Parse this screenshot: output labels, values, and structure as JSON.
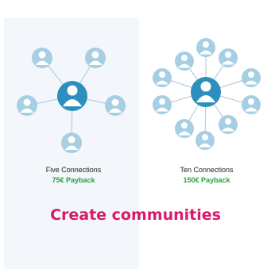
{
  "colors": {
    "node": "#a6cfe3",
    "hub": "#2d8fbe",
    "line": "#b7cfdd",
    "payback": "#2ea043",
    "headline": "#d81b6a"
  },
  "left_card": {
    "caption": "Five Connections",
    "payback": "75€ Payback"
  },
  "right_card": {
    "caption": "Ten Connections",
    "payback": "150€ Payback"
  },
  "headline": "Create communities"
}
